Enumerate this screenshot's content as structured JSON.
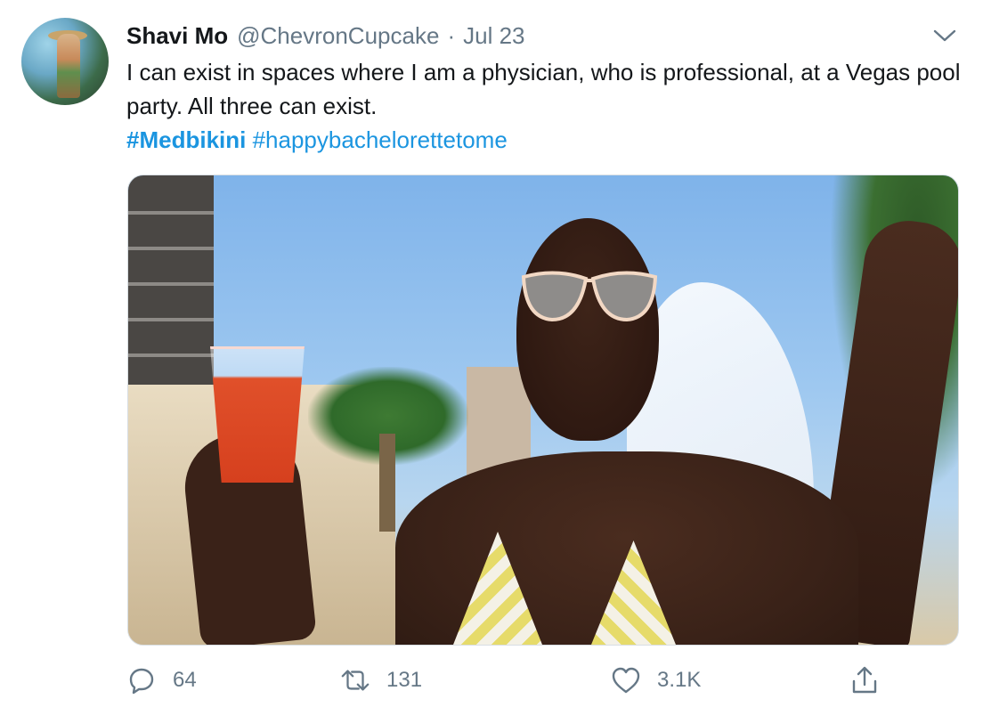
{
  "tweet": {
    "author_name": "Shavi Mo",
    "author_handle": "@ChevronCupcake",
    "separator": "·",
    "date": "Jul 23",
    "text": "I can exist in spaces where I am a physician, who is professional, at a Vegas pool party. All three can exist.",
    "hashtags": [
      {
        "label": "#Medbikini",
        "bold": true
      },
      {
        "label": "#happybachelorettetome",
        "bold": false
      }
    ],
    "media": {
      "alt": "photo"
    }
  },
  "actions": {
    "reply": {
      "count": "64",
      "icon": "reply-icon"
    },
    "retweet": {
      "count": "131",
      "icon": "retweet-icon"
    },
    "like": {
      "count": "3.1K",
      "icon": "heart-icon"
    },
    "share": {
      "icon": "share-icon"
    }
  },
  "colors": {
    "text": "#14171a",
    "secondary": "#657786",
    "link": "#1b95e0"
  }
}
